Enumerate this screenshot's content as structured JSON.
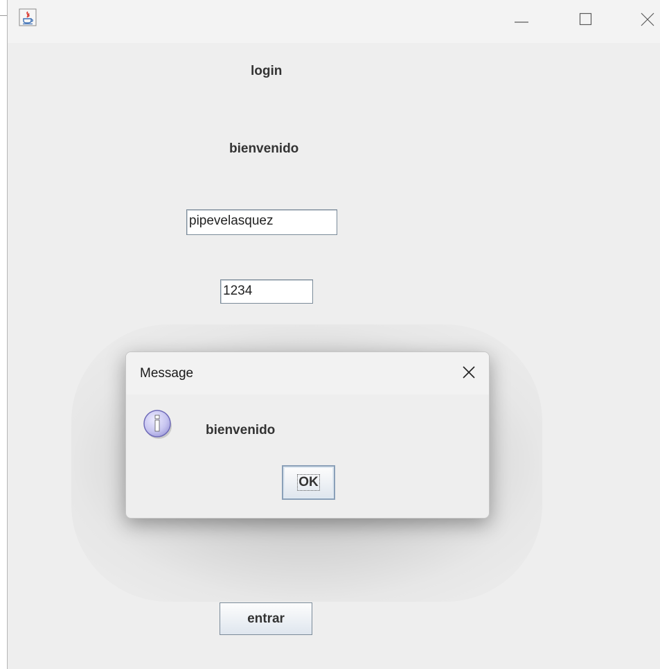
{
  "window": {
    "title": "",
    "controls": {
      "minimize_icon": "minimize-icon",
      "maximize_icon": "maximize-icon",
      "close_icon": "close-icon"
    }
  },
  "form": {
    "title_label": "login",
    "welcome_label": "bienvenido",
    "username_value": "pipevelasquez",
    "password_value": "1234",
    "submit_label": "entrar"
  },
  "dialog": {
    "title": "Message",
    "message": "bienvenido",
    "ok_label": "OK",
    "icon": "info-icon"
  },
  "colors": {
    "window_bg": "#eeeeee",
    "titlebar_bg": "#f3f3f3",
    "text": "#333333",
    "field_border": "#7a8a99",
    "button_gradient_bottom": "#dfe6ee",
    "info_icon_fill": "#c7c5f0"
  }
}
